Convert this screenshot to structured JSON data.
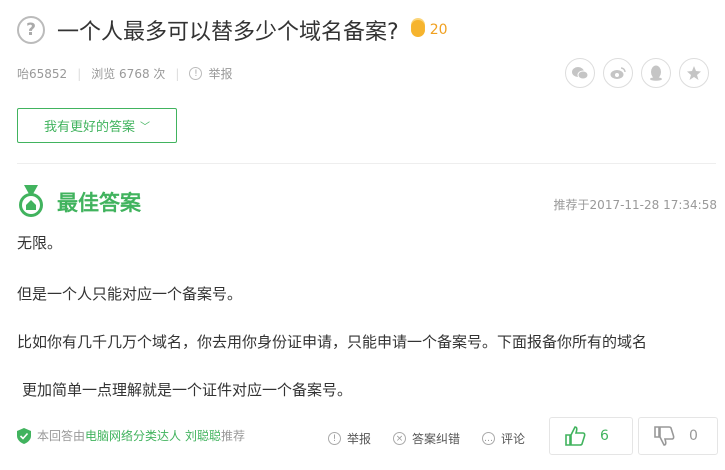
{
  "question": {
    "icon": "question-icon",
    "title": "一个人最多可以替多少个域名备案?",
    "reward": "20"
  },
  "meta": {
    "user": "咍65852",
    "views": "浏览 6768 次",
    "report": "举报"
  },
  "share_icons": [
    "wechat-icon",
    "weibo-icon",
    "qq-icon",
    "qzone-icon"
  ],
  "better_answer_button": "我有更好的答案",
  "best_answer": {
    "label": "最佳答案",
    "recommend_time": "推荐于2017-11-28 17:34:58",
    "lines": [
      "无限。",
      "但是一个人只能对应一个备案号。",
      "比如你有几千几万个域名，你去用你身份证申请，只能申请一个备案号。下面报备你所有的域名",
      "更加简单一点理解就是一个证件对应一个备案号。"
    ]
  },
  "footer": {
    "prefix": "本回答由",
    "category_link": "电脑网络分类达人",
    "user_link": "刘聪聪",
    "suffix": "推荐",
    "report": "举报",
    "dispute": "答案纠错",
    "comment": "评论",
    "likes": "6",
    "dislikes": "0"
  },
  "colors": {
    "accent": "#41b35e",
    "reward": "#f0a020"
  }
}
